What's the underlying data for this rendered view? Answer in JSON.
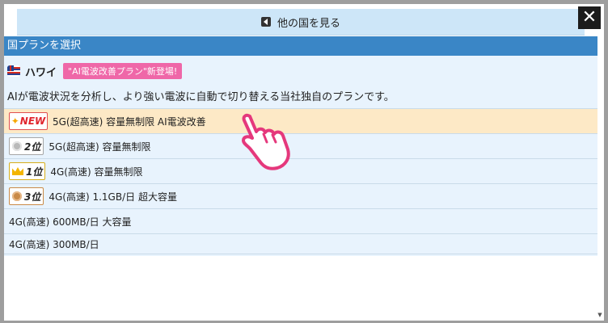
{
  "modal": {
    "back_button_label": "他の国を見る",
    "close_label": "✕",
    "section_title": "国プランを選択"
  },
  "country": {
    "name": "ハワイ",
    "badge": "\"AI電波改善プラン\"新登場!",
    "description": "AIが電波状況を分析し、より強い電波に自動で切り替える当社独自のプランです。"
  },
  "plans": [
    {
      "badge": "NEW",
      "badge_type": "new",
      "label": "5G(超高速) 容量無制限 AI電波改善",
      "highlighted": true
    },
    {
      "badge": "2位",
      "badge_type": "silver",
      "label": "5G(超高速) 容量無制限"
    },
    {
      "badge": "1位",
      "badge_type": "gold",
      "label": "4G(高速) 容量無制限"
    },
    {
      "badge": "3位",
      "badge_type": "bronze",
      "label": "4G(高速) 1.1GB/日 超大容量"
    },
    {
      "label": "4G(高速) 600MB/日 大容量"
    },
    {
      "label": "4G(高速) 300MB/日"
    }
  ],
  "colors": {
    "header_blue": "#3a86c6",
    "panel_bg": "#e8f3fd",
    "highlight_bg": "#fde9c6",
    "promo_pink": "#ef67a8",
    "new_red": "#e0252d",
    "cursor_pink": "#e5387c"
  }
}
